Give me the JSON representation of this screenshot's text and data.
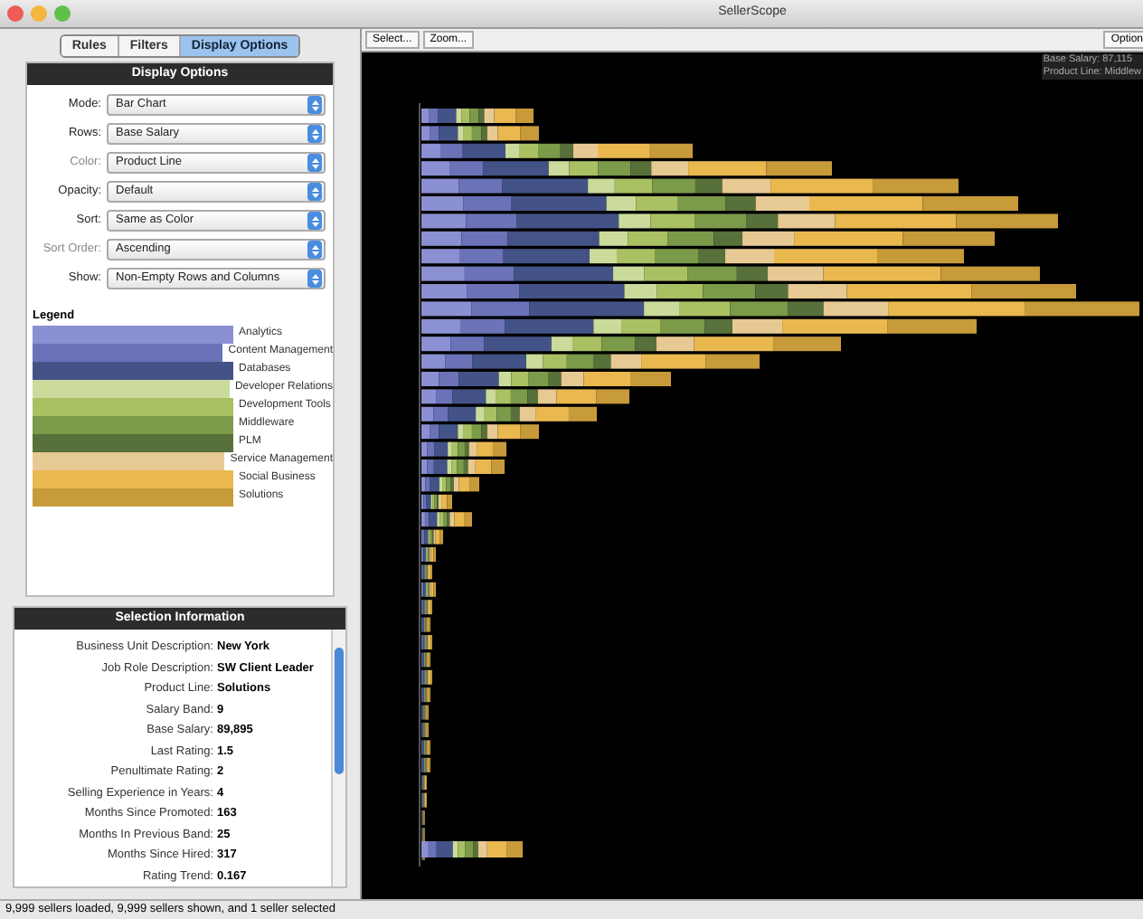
{
  "window": {
    "title": "SellerScope"
  },
  "tabs": [
    {
      "label": "Rules",
      "selected": false
    },
    {
      "label": "Filters",
      "selected": false
    },
    {
      "label": "Display Options",
      "selected": true
    }
  ],
  "display_options": {
    "title": "Display Options",
    "fields": [
      {
        "label": "Mode:",
        "value": "Bar Chart",
        "disabled": false
      },
      {
        "label": "Rows:",
        "value": "Base Salary",
        "disabled": false
      },
      {
        "label": "Color:",
        "value": "Product Line",
        "disabled": true
      },
      {
        "label": "Opacity:",
        "value": "Default",
        "disabled": false
      },
      {
        "label": "Sort:",
        "value": "Same as Color",
        "disabled": false
      },
      {
        "label": "Sort Order:",
        "value": "Ascending",
        "disabled": true
      },
      {
        "label": "Show:",
        "value": "Non-Empty Rows and Columns",
        "disabled": false
      }
    ]
  },
  "legend": {
    "title": "Legend",
    "items": [
      {
        "label": "Analytics",
        "color": "#8b90d2"
      },
      {
        "label": "Content Management",
        "color": "#6b72b8"
      },
      {
        "label": "Databases",
        "color": "#435387"
      },
      {
        "label": "Developer Relations",
        "color": "#cadb9b"
      },
      {
        "label": "Development Tools",
        "color": "#a9c163"
      },
      {
        "label": "Middleware",
        "color": "#7b9a4a"
      },
      {
        "label": "PLM",
        "color": "#58703a"
      },
      {
        "label": "Service Management",
        "color": "#e7c993"
      },
      {
        "label": "Social Business",
        "color": "#e9b84f"
      },
      {
        "label": "Solutions",
        "color": "#c79a3a"
      }
    ]
  },
  "selection_information": {
    "title": "Selection Information",
    "rows": [
      {
        "label": "Business Unit Description:",
        "value": "New York"
      },
      {
        "label": "Job Role Description:",
        "value": "SW Client Leader"
      },
      {
        "label": "Product Line:",
        "value": "Solutions"
      },
      {
        "label": "Salary Band:",
        "value": "9"
      },
      {
        "label": "Base Salary:",
        "value": "89,895"
      },
      {
        "label": "Last Rating:",
        "value": "1.5"
      },
      {
        "label": "Penultimate Rating:",
        "value": "2"
      },
      {
        "label": "Selling Experience in Years:",
        "value": "4"
      },
      {
        "label": "Months Since Promoted:",
        "value": "163"
      },
      {
        "label": "Months In Previous Band:",
        "value": "25"
      },
      {
        "label": "Months Since Hired:",
        "value": "317"
      },
      {
        "label": "Rating Trend:",
        "value": "0.167"
      }
    ]
  },
  "toolbar": {
    "buttons": [
      "Select...",
      "Zoom..."
    ],
    "right_button": "Option"
  },
  "chart_tooltip": [
    "Base Salary: 87,115",
    "Product Line: Middlew"
  ],
  "status_bar": "9,999 sellers loaded, 9,999 sellers shown, and 1 seller selected"
}
